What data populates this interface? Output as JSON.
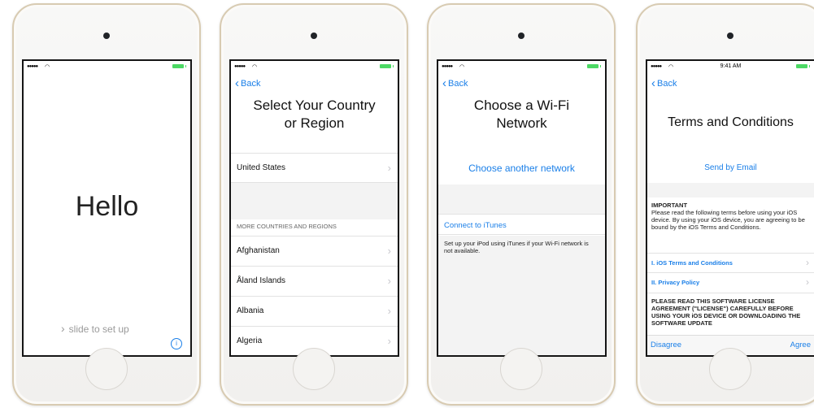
{
  "devices": [
    {
      "screen": "hello",
      "hello_text": "Hello",
      "slide_hint": "slide to set up",
      "info_icon": "info-icon"
    },
    {
      "screen": "country",
      "back_label": "Back",
      "title_line1": "Select Your Country",
      "title_line2": "or Region",
      "primary_country": "United States",
      "more_header": "MORE COUNTRIES AND REGIONS",
      "countries": [
        "Afghanistan",
        "Åland Islands",
        "Albania",
        "Algeria"
      ]
    },
    {
      "screen": "wifi",
      "back_label": "Back",
      "title_line1": "Choose a Wi-Fi",
      "title_line2": "Network",
      "choose_another": "Choose another network",
      "connect_itunes": "Connect to iTunes",
      "itunes_note": "Set up your iPod using iTunes if your Wi-Fi network is not available."
    },
    {
      "screen": "terms",
      "time": "9:41 AM",
      "back_label": "Back",
      "title": "Terms and Conditions",
      "send_email": "Send by Email",
      "important_heading": "IMPORTANT",
      "important_text": "Please read the following terms before using your iOS device. By using your iOS device, you are agreeing to be bound by the iOS Terms and Conditions.",
      "link1": "I. iOS Terms and Conditions",
      "link2": "II. Privacy Policy",
      "license_text": "PLEASE READ THIS SOFTWARE LICENSE AGREEMENT (\"LICENSE\") CAREFULLY BEFORE USING YOUR iOS DEVICE OR DOWNLOADING THE SOFTWARE UPDATE",
      "disagree": "Disagree",
      "agree": "Agree"
    }
  ],
  "colors": {
    "link_blue": "#1a7fe8",
    "battery_green": "#4cd964",
    "device_border_gold": "#d8cbb2"
  }
}
